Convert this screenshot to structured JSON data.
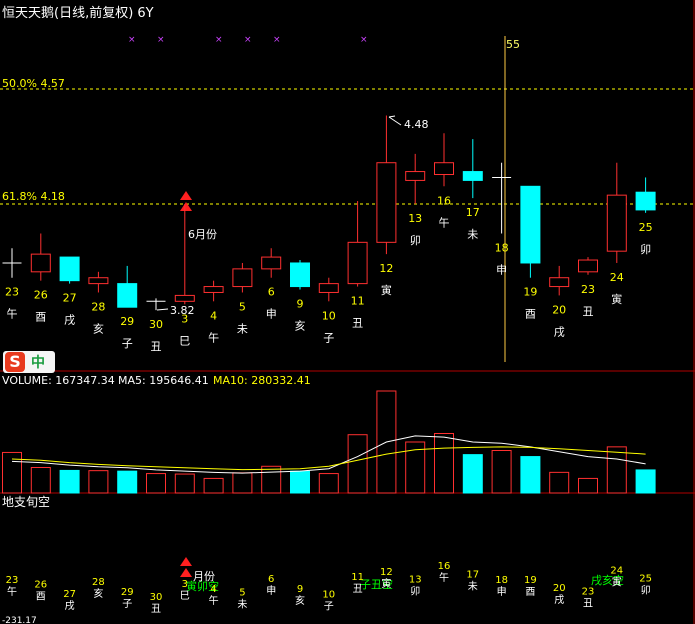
{
  "header": {
    "title": "恒天天鹅(日线,前复权) 6Y",
    "fib_50": "50.0% 4.57",
    "fib_618": "61.8% 4.18",
    "vertical_label": "55",
    "high_mark": "4.48",
    "low_mark": "3.82",
    "month_mark": "6月份"
  },
  "volume_header": {
    "volume": "VOLUME: 167347.34",
    "ma5": "MA5: 195646.41",
    "ma10": "MA10: 280332.41"
  },
  "indicator": {
    "title": "地支旬空",
    "labels": [
      "寅卯空",
      "子丑空",
      "戌亥空"
    ],
    "bottom_value": "-231.17",
    "month_mark": "月份"
  },
  "ime": {
    "logo": "S",
    "mode": "中"
  },
  "colors": {
    "up": "#ff3030",
    "down": "#00ffff",
    "yellow": "#ffff00",
    "grid": "#b00000"
  },
  "chart_data": {
    "type": "candlestick",
    "fib_levels": [
      {
        "label": "50.0%",
        "value": 4.57
      },
      {
        "label": "61.8%",
        "value": 4.18
      }
    ],
    "candles": [
      {
        "day": "23",
        "branch": "午",
        "o": 3.98,
        "h": 4.03,
        "l": 3.93,
        "c": 3.98
      },
      {
        "day": "26",
        "branch": "酉",
        "o": 3.95,
        "h": 4.08,
        "l": 3.92,
        "c": 4.01
      },
      {
        "day": "27",
        "branch": "戌",
        "o": 4.0,
        "h": 4.0,
        "l": 3.91,
        "c": 3.92
      },
      {
        "day": "28",
        "branch": "亥",
        "o": 3.91,
        "h": 3.95,
        "l": 3.88,
        "c": 3.93
      },
      {
        "day": "29",
        "branch": "子",
        "o": 3.91,
        "h": 3.97,
        "l": 3.83,
        "c": 3.83
      },
      {
        "day": "30",
        "branch": "丑",
        "o": 3.84,
        "h": 3.86,
        "l": 3.82,
        "c": 3.85
      },
      {
        "day": "3",
        "branch": "巳",
        "o": 3.85,
        "h": 4.18,
        "l": 3.84,
        "c": 3.87
      },
      {
        "day": "4",
        "branch": "午",
        "o": 3.88,
        "h": 3.92,
        "l": 3.85,
        "c": 3.9
      },
      {
        "day": "5",
        "branch": "未",
        "o": 3.9,
        "h": 3.98,
        "l": 3.88,
        "c": 3.96
      },
      {
        "day": "6",
        "branch": "申",
        "o": 3.96,
        "h": 4.03,
        "l": 3.93,
        "c": 4.0
      },
      {
        "day": "9",
        "branch": "亥",
        "o": 3.98,
        "h": 3.99,
        "l": 3.89,
        "c": 3.9
      },
      {
        "day": "10",
        "branch": "子",
        "o": 3.88,
        "h": 3.93,
        "l": 3.85,
        "c": 3.91
      },
      {
        "day": "11",
        "branch": "丑",
        "o": 3.91,
        "h": 4.19,
        "l": 3.9,
        "c": 4.05
      },
      {
        "day": "12",
        "branch": "寅",
        "o": 4.05,
        "h": 4.48,
        "l": 4.01,
        "c": 4.32
      },
      {
        "day": "13",
        "branch": "卯",
        "o": 4.26,
        "h": 4.35,
        "l": 4.18,
        "c": 4.29
      },
      {
        "day": "16",
        "branch": "午",
        "o": 4.28,
        "h": 4.42,
        "l": 4.24,
        "c": 4.32
      },
      {
        "day": "17",
        "branch": "未",
        "o": 4.29,
        "h": 4.4,
        "l": 4.2,
        "c": 4.26
      },
      {
        "day": "18",
        "branch": "申",
        "o": 4.26,
        "h": 4.32,
        "l": 4.08,
        "c": 4.27
      },
      {
        "day": "19",
        "branch": "酉",
        "o": 4.24,
        "h": 4.24,
        "l": 3.93,
        "c": 3.98
      },
      {
        "day": "20",
        "branch": "戌",
        "o": 3.9,
        "h": 3.97,
        "l": 3.87,
        "c": 3.93
      },
      {
        "day": "23",
        "branch": "丑",
        "o": 3.95,
        "h": 4.0,
        "l": 3.94,
        "c": 3.99
      },
      {
        "day": "24",
        "branch": "寅",
        "o": 4.02,
        "h": 4.32,
        "l": 3.98,
        "c": 4.21
      },
      {
        "day": "25",
        "branch": "卯",
        "o": 4.22,
        "h": 4.27,
        "l": 4.15,
        "c": 4.16
      }
    ],
    "volume": [
      167000,
      105000,
      93000,
      92000,
      90000,
      80000,
      78000,
      60000,
      83000,
      110000,
      90000,
      80000,
      240000,
      420000,
      210000,
      245000,
      158000,
      175000,
      150000,
      85000,
      60000,
      190000,
      95000
    ],
    "ma5": [
      130000,
      125000,
      115000,
      108000,
      104000,
      95000,
      90000,
      85000,
      82000,
      86000,
      90000,
      100000,
      150000,
      210000,
      235000,
      230000,
      210000,
      205000,
      190000,
      170000,
      150000,
      140000,
      120000
    ],
    "ma10": [
      140000,
      135000,
      125000,
      118000,
      112000,
      108000,
      104000,
      100000,
      96000,
      98000,
      100000,
      110000,
      135000,
      160000,
      178000,
      185000,
      188000,
      190000,
      188000,
      182000,
      175000,
      168000,
      160000
    ]
  }
}
